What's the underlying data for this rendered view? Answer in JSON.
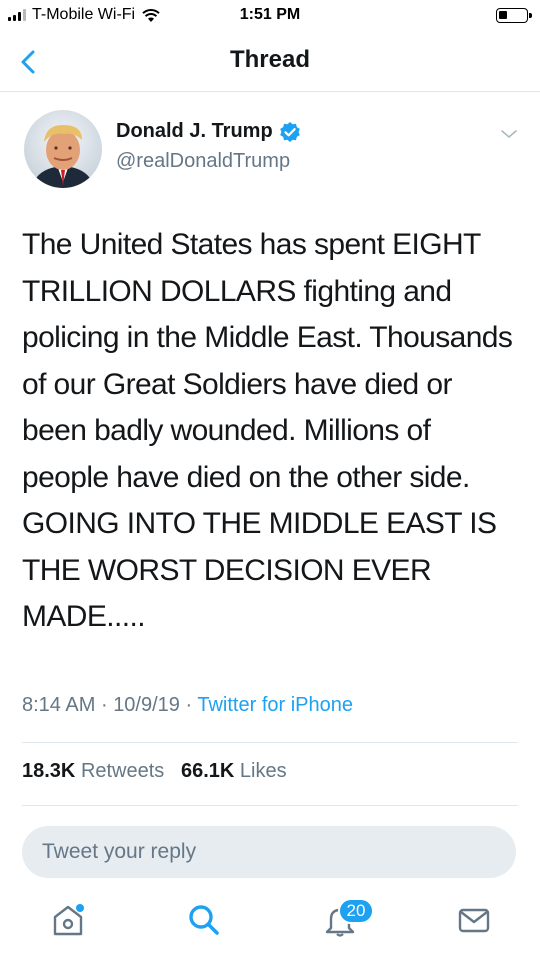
{
  "status_bar": {
    "carrier": "T-Mobile Wi-Fi",
    "time": "1:51 PM",
    "battery_level": 0.25
  },
  "nav": {
    "title": "Thread",
    "back_icon": "chevron-left-icon"
  },
  "tweet": {
    "author_name": "Donald J. Trump",
    "handle": "@realDonaldTrump",
    "verified": true,
    "text": "The United States has spent EIGHT TRILLION DOLLARS fighting and policing in the Middle East. Thousands of our Great Soldiers have died or been badly wounded. Millions of people have died on the other side. GOING INTO THE MIDDLE EAST IS THE WORST DECISION EVER MADE.....",
    "time": "8:14 AM",
    "date": "10/9/19",
    "separator": "·",
    "source": "Twitter for iPhone",
    "retweets_count": "18.3K",
    "retweets_label": "Retweets",
    "likes_count": "66.1K",
    "likes_label": "Likes"
  },
  "reply": {
    "placeholder": "Tweet your reply"
  },
  "tab_bar": {
    "notification_badge": "20"
  },
  "colors": {
    "accent": "#1da1f2",
    "text": "#14171a",
    "secondary_text": "#657786",
    "divider": "#e1e8ed",
    "reply_bg": "#e6ecf0"
  }
}
